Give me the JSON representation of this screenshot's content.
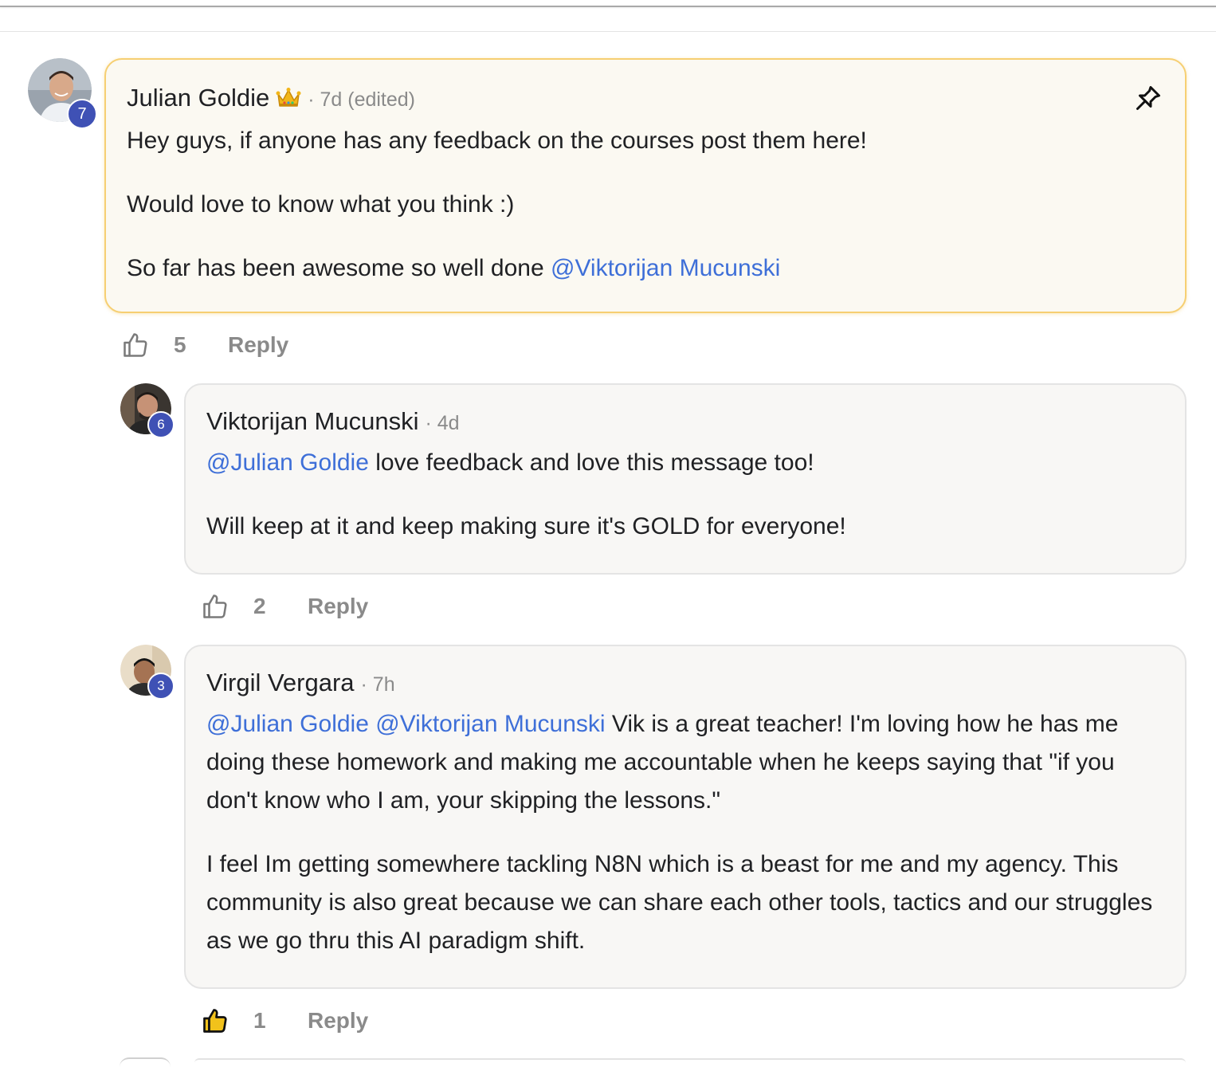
{
  "colors": {
    "mention": "#3e6fd8",
    "level_badge": "#3f51b5",
    "pinned_border": "#f6cf72",
    "muted_text": "#8a8a8a"
  },
  "comments": [
    {
      "author": "Julian Goldie",
      "badge_icon": "crown-icon",
      "meta": "· 7d (edited)",
      "level": "7",
      "pinned": true,
      "pin_icon": "pin-icon",
      "paragraphs": [
        [
          {
            "text": "Hey guys, if anyone has any feedback on the courses post them here!"
          }
        ],
        [
          {
            "text": "Would love to know what you think :)"
          }
        ],
        [
          {
            "text": "So far has been awesome so well done "
          },
          {
            "mention": "@Viktorijan Mucunski"
          }
        ]
      ],
      "likes": "5",
      "liked": false,
      "reply_label": "Reply"
    },
    {
      "author": "Viktorijan Mucunski",
      "meta": "· 4d",
      "level": "6",
      "pinned": false,
      "paragraphs": [
        [
          {
            "mention": "@Julian Goldie"
          },
          {
            "text": " love feedback and love this message too!"
          }
        ],
        [
          {
            "text": "Will keep at it and keep making sure it's GOLD for everyone!"
          }
        ]
      ],
      "likes": "2",
      "liked": false,
      "reply_label": "Reply"
    },
    {
      "author": "Virgil Vergara",
      "meta": "· 7h",
      "level": "3",
      "pinned": false,
      "paragraphs": [
        [
          {
            "mention": "@Julian Goldie"
          },
          {
            "text": " "
          },
          {
            "mention": "@Viktorijan Mucunski"
          },
          {
            "text": " Vik is a great teacher! I'm loving how he has me doing these homework and making me accountable when he keeps saying that \"if you don't know who I am, your skipping the lessons.\""
          }
        ],
        [
          {
            "text": "I feel Im getting somewhere tackling N8N which is a beast for me and my agency. This community is also great because we can share each other tools, tactics and our struggles as we go thru this AI paradigm shift."
          }
        ]
      ],
      "likes": "1",
      "liked": true,
      "reply_label": "Reply"
    }
  ]
}
